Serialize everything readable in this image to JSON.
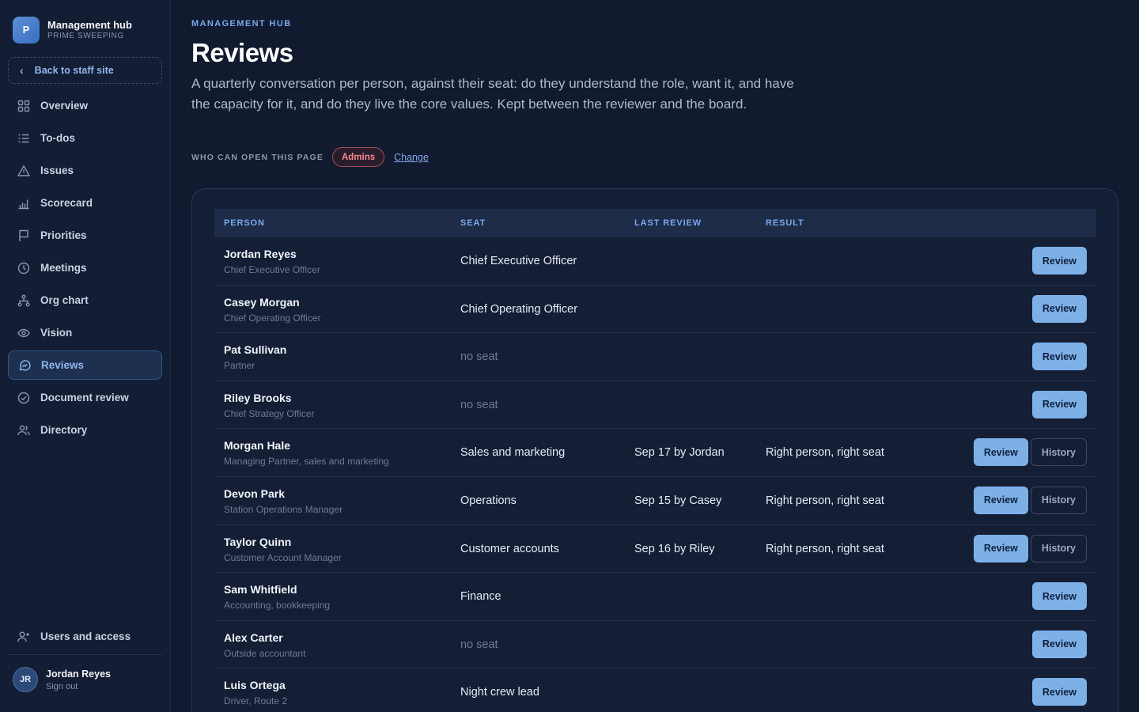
{
  "brand": {
    "logo_letter": "P",
    "title": "Management hub",
    "subtitle": "PRIME SWEEPING"
  },
  "back_link": {
    "label": "Back to staff site"
  },
  "nav": [
    {
      "label": "Overview",
      "icon": "grid-icon",
      "active": false
    },
    {
      "label": "To-dos",
      "icon": "list-icon",
      "active": false
    },
    {
      "label": "Issues",
      "icon": "warning-triangle-icon",
      "active": false
    },
    {
      "label": "Scorecard",
      "icon": "bar-chart-icon",
      "active": false
    },
    {
      "label": "Priorities",
      "icon": "flag-icon",
      "active": false
    },
    {
      "label": "Meetings",
      "icon": "clock-icon",
      "active": false
    },
    {
      "label": "Org chart",
      "icon": "org-chart-icon",
      "active": false
    },
    {
      "label": "Vision",
      "icon": "eye-icon",
      "active": false
    },
    {
      "label": "Reviews",
      "icon": "chat-bubble-icon",
      "active": true
    },
    {
      "label": "Document review",
      "icon": "check-circle-icon",
      "active": false
    },
    {
      "label": "Directory",
      "icon": "people-icon",
      "active": false
    }
  ],
  "users_access": {
    "label": "Users and access",
    "icon": "user-plus-icon"
  },
  "user": {
    "initials": "JR",
    "name": "Jordan Reyes",
    "signout": "Sign out"
  },
  "page": {
    "eyebrow": "MANAGEMENT HUB",
    "title": "Reviews",
    "description": "A quarterly conversation per person, against their seat: do they understand the role, want it, and have the capacity for it, and do they live the core values. Kept between the reviewer and the board.",
    "access_label": "WHO CAN OPEN THIS PAGE",
    "access_badge": "Admins",
    "access_change": "Change"
  },
  "table": {
    "headers": {
      "person": "PERSON",
      "seat": "SEAT",
      "last_review": "LAST REVIEW",
      "result": "RESULT"
    },
    "review_label": "Review",
    "history_label": "History",
    "rows": [
      {
        "name": "Jordan Reyes",
        "role": "Chief Executive Officer",
        "seat": "Chief Executive Officer",
        "seat_empty": false,
        "last_review": "",
        "result": "",
        "has_history": false
      },
      {
        "name": "Casey Morgan",
        "role": "Chief Operating Officer",
        "seat": "Chief Operating Officer",
        "seat_empty": false,
        "last_review": "",
        "result": "",
        "has_history": false
      },
      {
        "name": "Pat Sullivan",
        "role": "Partner",
        "seat": "no seat",
        "seat_empty": true,
        "last_review": "",
        "result": "",
        "has_history": false
      },
      {
        "name": "Riley Brooks",
        "role": "Chief Strategy Officer",
        "seat": "no seat",
        "seat_empty": true,
        "last_review": "",
        "result": "",
        "has_history": false
      },
      {
        "name": "Morgan Hale",
        "role": "Managing Partner, sales and marketing",
        "seat": "Sales and marketing",
        "seat_empty": false,
        "last_review": "Sep 17 by Jordan",
        "result": "Right person, right seat",
        "has_history": true
      },
      {
        "name": "Devon Park",
        "role": "Station Operations Manager",
        "seat": "Operations",
        "seat_empty": false,
        "last_review": "Sep 15 by Casey",
        "result": "Right person, right seat",
        "has_history": true
      },
      {
        "name": "Taylor Quinn",
        "role": "Customer Account Manager",
        "seat": "Customer accounts",
        "seat_empty": false,
        "last_review": "Sep 16 by Riley",
        "result": "Right person, right seat",
        "has_history": true
      },
      {
        "name": "Sam Whitfield",
        "role": "Accounting, bookkeeping",
        "seat": "Finance",
        "seat_empty": false,
        "last_review": "",
        "result": "",
        "has_history": false
      },
      {
        "name": "Alex Carter",
        "role": "Outside accountant",
        "seat": "no seat",
        "seat_empty": true,
        "last_review": "",
        "result": "",
        "has_history": false
      },
      {
        "name": "Luis Ortega",
        "role": "Driver, Route 2",
        "seat": "Night crew lead",
        "seat_empty": false,
        "last_review": "",
        "result": "",
        "has_history": false
      }
    ]
  }
}
